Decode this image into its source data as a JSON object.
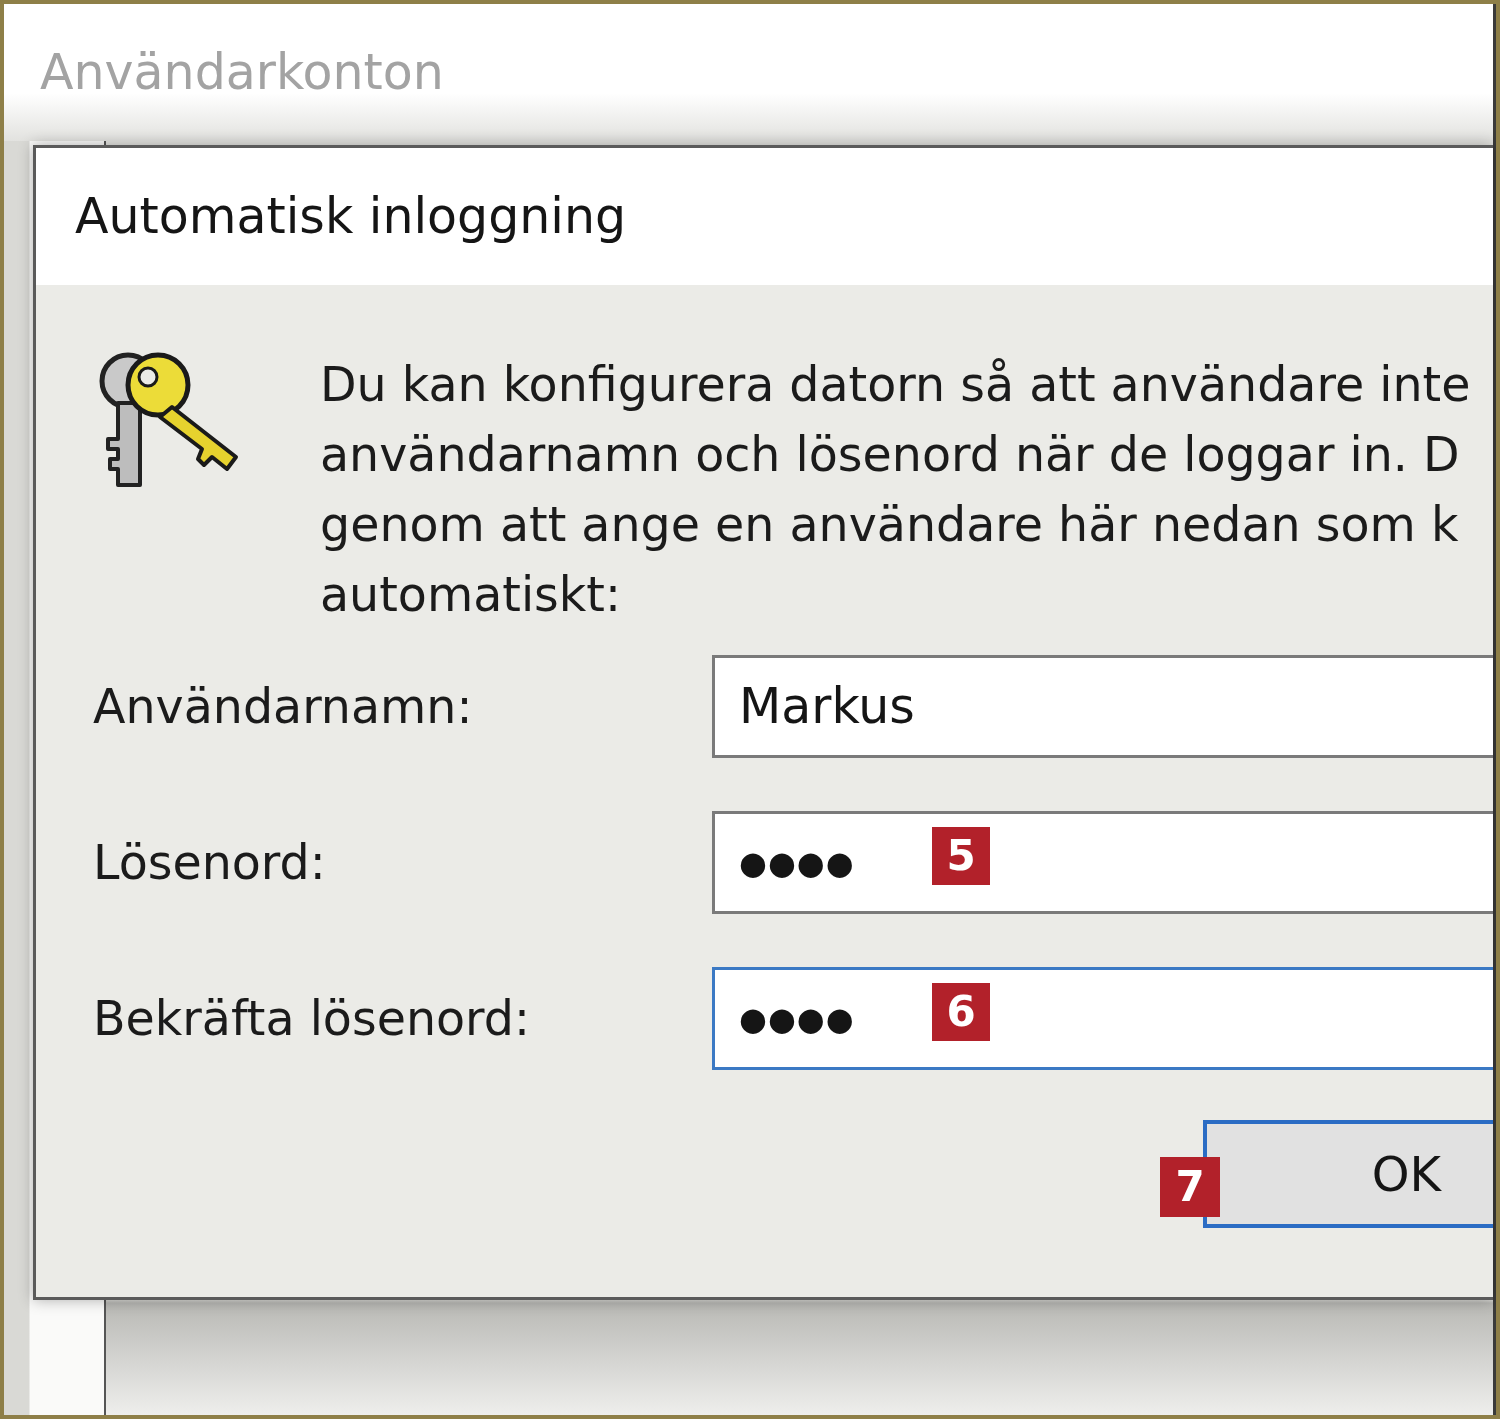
{
  "background_window": {
    "title": "Användarkonton"
  },
  "dialog": {
    "title": "Automatisk inloggning",
    "description_lines": [
      "Du kan konfigurera datorn så att användare inte",
      "användarnamn och lösenord när de loggar in. D",
      "genom att ange en användare här nedan som k",
      "automatiskt:"
    ],
    "fields": [
      {
        "label": "Användarnamn:",
        "kind": "text",
        "value": "Markus",
        "focused": false
      },
      {
        "label": "Lösenord:",
        "kind": "password",
        "value": "●●●●",
        "focused": false,
        "marker": "5"
      },
      {
        "label": "Bekräfta lösenord:",
        "kind": "password",
        "value": "●●●●",
        "focused": true,
        "marker": "6"
      }
    ],
    "buttons": [
      {
        "label": "OK",
        "default": true,
        "marker": "7"
      }
    ]
  }
}
